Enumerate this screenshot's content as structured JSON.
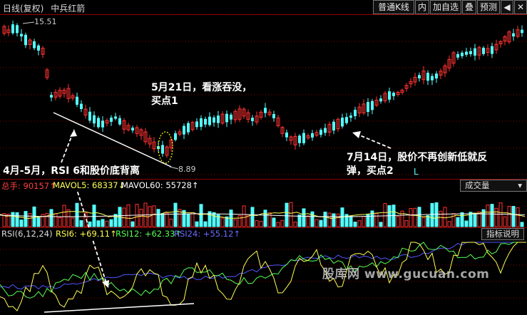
{
  "toolbar": {
    "title": "日线(复权)",
    "stock_name": "中兵红箭",
    "buttons": [
      "普通K线",
      "内",
      "加自选",
      "叠",
      "预测",
      "◀",
      "✕"
    ]
  },
  "main_chart": {
    "high_label": "15.51",
    "low_label": "8.89",
    "bottom_marker": "L"
  },
  "annotations": {
    "buy1": [
      "5月21日，看涨吞没，",
      "买点1"
    ],
    "buy2": [
      "7月14日，股价不再创新低就反",
      "弹，买点2"
    ],
    "divergence": "4月-5月，RSI 6和股价底背离"
  },
  "volume_bar": {
    "total": "总手: 90157↑",
    "mavol5": "MAVOL5: 68337↓",
    "mavol60": "MAVOL60: 55728↑",
    "dropdown": "成交量"
  },
  "rsi_bar": {
    "params": "RSI(6,12,24)",
    "rsi6": "RSI6: +69.11↑",
    "rsi12": "RSI12: +62.33↑",
    "rsi24": "RSI24: +55.12↑",
    "help_button": "指标说明"
  },
  "watermark": "股库网 www.gucuan.com",
  "colors": {
    "up": "#ff3232",
    "down": "#54ffff",
    "rsi6": "#ffff55",
    "rsi12": "#55ff55",
    "rsi24": "#5555ff",
    "grid": "#8a0000"
  }
}
